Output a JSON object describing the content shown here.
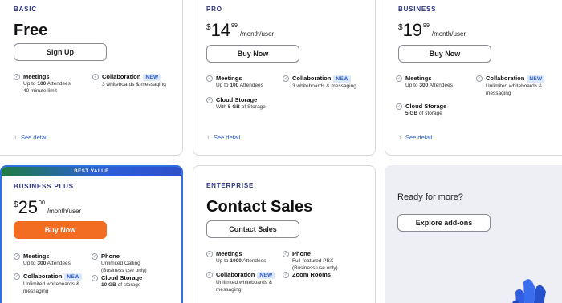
{
  "basic": {
    "tier": "BASIC",
    "heading": "Free",
    "button": "Sign Up",
    "features": [
      {
        "title": "Meetings",
        "line1_pre": "Up to ",
        "line1_bold": "100",
        "line1_post": " Attendees",
        "line2": "40 minute limit"
      },
      {
        "title": "Collaboration",
        "badge": "NEW",
        "line1": "3 whiteboards & messaging"
      }
    ],
    "detail": "See detail"
  },
  "pro": {
    "tier": "PRO",
    "currency": "$",
    "amount": "14",
    "cents": "99",
    "per": "/month/user",
    "button": "Buy Now",
    "features": [
      {
        "title": "Meetings",
        "line1_pre": "Up to ",
        "line1_bold": "100",
        "line1_post": " Attendees"
      },
      {
        "title": "Collaboration",
        "badge": "NEW",
        "line1": "3 whiteboards & messaging"
      },
      {
        "title": "Cloud Storage",
        "line1_pre": "With ",
        "line1_bold": "5 GB",
        "line1_post": " of Storage"
      }
    ],
    "detail": "See detail"
  },
  "business": {
    "tier": "BUSINESS",
    "currency": "$",
    "amount": "19",
    "cents": "99",
    "per": "/month/user",
    "button": "Buy Now",
    "features": [
      {
        "title": "Meetings",
        "line1_pre": "Up to ",
        "line1_bold": "300",
        "line1_post": " Attendees"
      },
      {
        "title": "Collaboration",
        "badge": "NEW",
        "line1": "Unlimited whiteboards &",
        "line2": "messaging"
      },
      {
        "title": "Cloud Storage",
        "line1_bold": "5 GB",
        "line1_post": " of storage"
      }
    ],
    "detail": "See detail"
  },
  "business_plus": {
    "ribbon": "BEST VALUE",
    "tier": "BUSINESS PLUS",
    "currency": "$",
    "amount": "25",
    "cents": "00",
    "per": "/month/user",
    "button": "Buy Now",
    "features": [
      {
        "title": "Meetings",
        "line1_pre": "Up to ",
        "line1_bold": "300",
        "line1_post": " Attendees"
      },
      {
        "title": "Phone",
        "line1": "Unlimited Calling",
        "line2": "(Business use only)"
      },
      {
        "title": "Collaboration",
        "badge": "NEW",
        "line1": "Unlimited whiteboards &",
        "line2": "messaging"
      },
      {
        "title": "Cloud Storage",
        "line1_bold": "10 GB",
        "line1_post": " of storage"
      }
    ]
  },
  "enterprise": {
    "tier": "ENTERPRISE",
    "heading": "Contact Sales",
    "button": "Contact Sales",
    "features": [
      {
        "title": "Meetings",
        "line1_pre": "Up to ",
        "line1_bold": "1000",
        "line1_post": " Attendees"
      },
      {
        "title": "Phone",
        "line1": "Full-featured PBX",
        "line2": "(Business use only)"
      },
      {
        "title": "Collaboration",
        "badge": "NEW",
        "line1": "Unlimited whiteboards &",
        "line2": "messaging"
      },
      {
        "title": "Zoom Rooms"
      }
    ]
  },
  "addons": {
    "title": "Ready for more?",
    "button": "Explore add-ons"
  },
  "colors": {
    "accent_orange": "#f26d21",
    "link_blue": "#2b5ec8",
    "tier_navy": "#2d3380",
    "best_value_border": "#2f6fe0"
  }
}
